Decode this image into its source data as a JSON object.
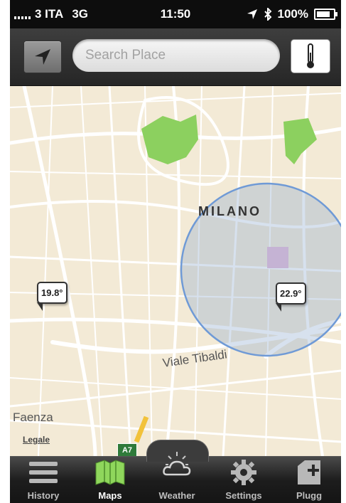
{
  "status_bar": {
    "carrier": "3 ITA",
    "network": "3G",
    "time": "11:50",
    "battery": "100%",
    "battery_level": 1.0
  },
  "toolbar": {
    "search_placeholder": "Search Place",
    "locate_icon": "location-arrow-icon",
    "thermometer_icon": "thermometer-icon"
  },
  "map": {
    "city_label": "Milano",
    "street_label_1": "Viale Tibaldi",
    "street_label_2": "Faenza",
    "highway_badge": "A7",
    "legal_link": "Legale",
    "pins": [
      {
        "temperature": "19.8°"
      },
      {
        "temperature": "22.9°"
      }
    ],
    "colors": {
      "land": "#f3ead6",
      "park": "#8cd05f",
      "circle": "#6f9ad6",
      "highway": "#f2c23a"
    }
  },
  "tabs": [
    {
      "label": "History",
      "icon": "list-icon",
      "active": false
    },
    {
      "label": "Maps",
      "icon": "map-icon",
      "active": true
    },
    {
      "label": "Weather",
      "icon": "cloud-sun-icon",
      "active": false
    },
    {
      "label": "Settings",
      "icon": "gear-icon",
      "active": false
    },
    {
      "label": "Plugg",
      "icon": "plug-add-icon",
      "active": false
    }
  ]
}
